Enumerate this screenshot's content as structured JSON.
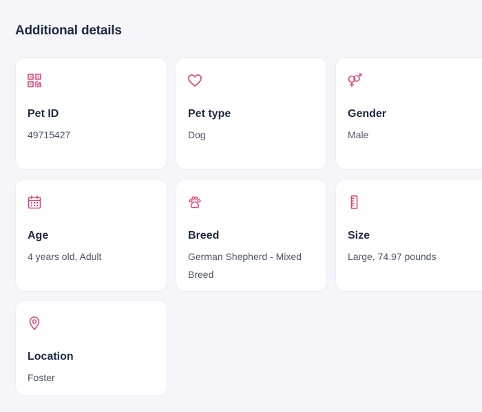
{
  "section": {
    "title": "Additional details"
  },
  "accent_color": "#e0457b",
  "cards": [
    {
      "icon": "qr-code-icon",
      "label": "Pet ID",
      "value": "49715427"
    },
    {
      "icon": "heart-icon",
      "label": "Pet type",
      "value": "Dog"
    },
    {
      "icon": "gender-symbols-icon",
      "label": "Gender",
      "value": "Male"
    },
    {
      "icon": "calendar-icon",
      "label": "Age",
      "value": "4 years old, Adult"
    },
    {
      "icon": "paw-print-icon",
      "label": "Breed",
      "value": "German Shepherd - Mixed Breed"
    },
    {
      "icon": "ruler-icon",
      "label": "Size",
      "value": "Large, 74.97 pounds"
    },
    {
      "icon": "location-pin-icon",
      "label": "Location",
      "value": "Foster"
    }
  ]
}
